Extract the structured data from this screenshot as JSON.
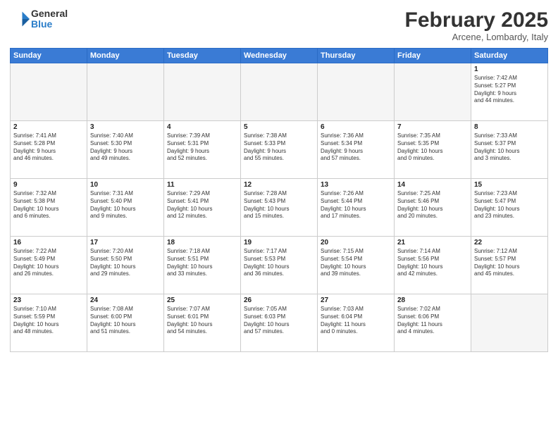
{
  "logo": {
    "general": "General",
    "blue": "Blue"
  },
  "header": {
    "month": "February 2025",
    "location": "Arcene, Lombardy, Italy"
  },
  "weekdays": [
    "Sunday",
    "Monday",
    "Tuesday",
    "Wednesday",
    "Thursday",
    "Friday",
    "Saturday"
  ],
  "weeks": [
    [
      {
        "day": "",
        "info": ""
      },
      {
        "day": "",
        "info": ""
      },
      {
        "day": "",
        "info": ""
      },
      {
        "day": "",
        "info": ""
      },
      {
        "day": "",
        "info": ""
      },
      {
        "day": "",
        "info": ""
      },
      {
        "day": "1",
        "info": "Sunrise: 7:42 AM\nSunset: 5:27 PM\nDaylight: 9 hours\nand 44 minutes."
      }
    ],
    [
      {
        "day": "2",
        "info": "Sunrise: 7:41 AM\nSunset: 5:28 PM\nDaylight: 9 hours\nand 46 minutes."
      },
      {
        "day": "3",
        "info": "Sunrise: 7:40 AM\nSunset: 5:30 PM\nDaylight: 9 hours\nand 49 minutes."
      },
      {
        "day": "4",
        "info": "Sunrise: 7:39 AM\nSunset: 5:31 PM\nDaylight: 9 hours\nand 52 minutes."
      },
      {
        "day": "5",
        "info": "Sunrise: 7:38 AM\nSunset: 5:33 PM\nDaylight: 9 hours\nand 55 minutes."
      },
      {
        "day": "6",
        "info": "Sunrise: 7:36 AM\nSunset: 5:34 PM\nDaylight: 9 hours\nand 57 minutes."
      },
      {
        "day": "7",
        "info": "Sunrise: 7:35 AM\nSunset: 5:35 PM\nDaylight: 10 hours\nand 0 minutes."
      },
      {
        "day": "8",
        "info": "Sunrise: 7:33 AM\nSunset: 5:37 PM\nDaylight: 10 hours\nand 3 minutes."
      }
    ],
    [
      {
        "day": "9",
        "info": "Sunrise: 7:32 AM\nSunset: 5:38 PM\nDaylight: 10 hours\nand 6 minutes."
      },
      {
        "day": "10",
        "info": "Sunrise: 7:31 AM\nSunset: 5:40 PM\nDaylight: 10 hours\nand 9 minutes."
      },
      {
        "day": "11",
        "info": "Sunrise: 7:29 AM\nSunset: 5:41 PM\nDaylight: 10 hours\nand 12 minutes."
      },
      {
        "day": "12",
        "info": "Sunrise: 7:28 AM\nSunset: 5:43 PM\nDaylight: 10 hours\nand 15 minutes."
      },
      {
        "day": "13",
        "info": "Sunrise: 7:26 AM\nSunset: 5:44 PM\nDaylight: 10 hours\nand 17 minutes."
      },
      {
        "day": "14",
        "info": "Sunrise: 7:25 AM\nSunset: 5:46 PM\nDaylight: 10 hours\nand 20 minutes."
      },
      {
        "day": "15",
        "info": "Sunrise: 7:23 AM\nSunset: 5:47 PM\nDaylight: 10 hours\nand 23 minutes."
      }
    ],
    [
      {
        "day": "16",
        "info": "Sunrise: 7:22 AM\nSunset: 5:49 PM\nDaylight: 10 hours\nand 26 minutes."
      },
      {
        "day": "17",
        "info": "Sunrise: 7:20 AM\nSunset: 5:50 PM\nDaylight: 10 hours\nand 29 minutes."
      },
      {
        "day": "18",
        "info": "Sunrise: 7:18 AM\nSunset: 5:51 PM\nDaylight: 10 hours\nand 33 minutes."
      },
      {
        "day": "19",
        "info": "Sunrise: 7:17 AM\nSunset: 5:53 PM\nDaylight: 10 hours\nand 36 minutes."
      },
      {
        "day": "20",
        "info": "Sunrise: 7:15 AM\nSunset: 5:54 PM\nDaylight: 10 hours\nand 39 minutes."
      },
      {
        "day": "21",
        "info": "Sunrise: 7:14 AM\nSunset: 5:56 PM\nDaylight: 10 hours\nand 42 minutes."
      },
      {
        "day": "22",
        "info": "Sunrise: 7:12 AM\nSunset: 5:57 PM\nDaylight: 10 hours\nand 45 minutes."
      }
    ],
    [
      {
        "day": "23",
        "info": "Sunrise: 7:10 AM\nSunset: 5:59 PM\nDaylight: 10 hours\nand 48 minutes."
      },
      {
        "day": "24",
        "info": "Sunrise: 7:08 AM\nSunset: 6:00 PM\nDaylight: 10 hours\nand 51 minutes."
      },
      {
        "day": "25",
        "info": "Sunrise: 7:07 AM\nSunset: 6:01 PM\nDaylight: 10 hours\nand 54 minutes."
      },
      {
        "day": "26",
        "info": "Sunrise: 7:05 AM\nSunset: 6:03 PM\nDaylight: 10 hours\nand 57 minutes."
      },
      {
        "day": "27",
        "info": "Sunrise: 7:03 AM\nSunset: 6:04 PM\nDaylight: 11 hours\nand 0 minutes."
      },
      {
        "day": "28",
        "info": "Sunrise: 7:02 AM\nSunset: 6:06 PM\nDaylight: 11 hours\nand 4 minutes."
      },
      {
        "day": "",
        "info": ""
      }
    ]
  ]
}
